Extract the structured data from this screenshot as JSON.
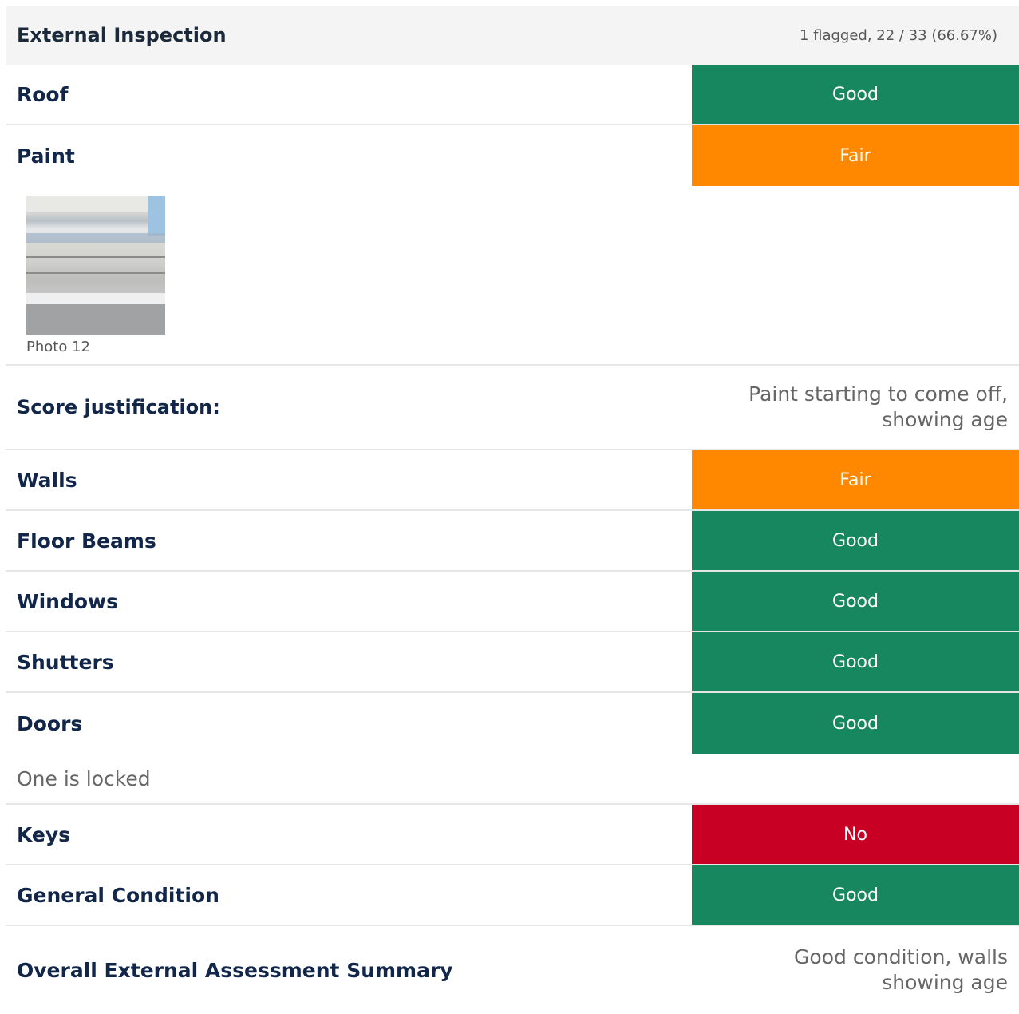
{
  "section": {
    "title": "External Inspection",
    "stats": "1 flagged, 22 / 33 (66.67%)"
  },
  "items": [
    {
      "label": "Roof",
      "value": "Good",
      "status_color": "#16875f"
    },
    {
      "label": "Paint",
      "value": "Fair",
      "status_color": "#ff8800"
    },
    {
      "label": "Walls",
      "value": "Fair",
      "status_color": "#ff8800"
    },
    {
      "label": "Floor Beams",
      "value": "Good",
      "status_color": "#16875f"
    },
    {
      "label": "Windows",
      "value": "Good",
      "status_color": "#16875f"
    },
    {
      "label": "Shutters",
      "value": "Good",
      "status_color": "#16875f"
    },
    {
      "label": "Doors",
      "value": "Good",
      "status_color": "#16875f"
    },
    {
      "label": "Keys",
      "value": "No",
      "status_color": "#c80024"
    },
    {
      "label": "General Condition",
      "value": "Good",
      "status_color": "#16875f"
    }
  ],
  "paint_photo": {
    "caption": "Photo 12"
  },
  "score_justification": {
    "label": "Score justification:",
    "text": "Paint starting to come off, showing age"
  },
  "doors_note": "One is locked",
  "summary": {
    "label": "Overall External Assessment Summary",
    "text": "Good condition, walls showing age"
  }
}
